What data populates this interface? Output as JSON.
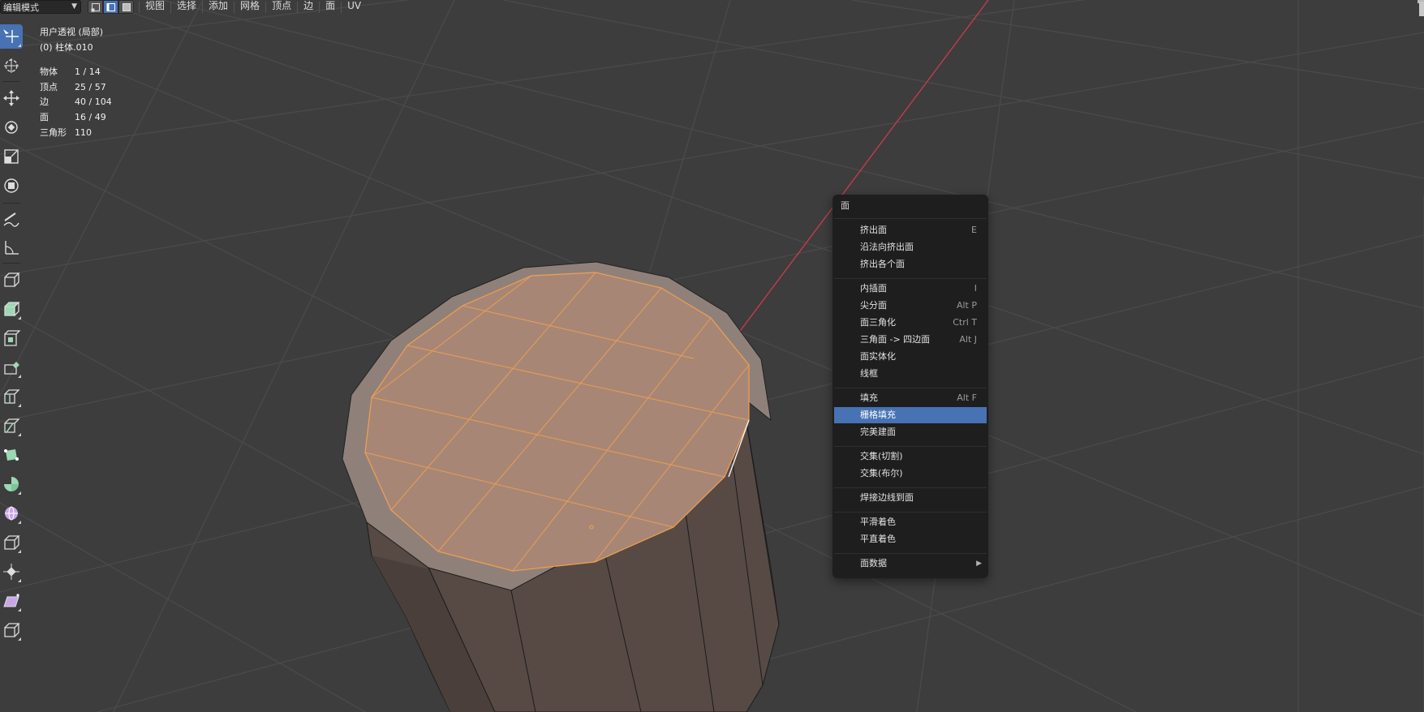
{
  "header": {
    "mode": "编辑模式",
    "menus": [
      "视图",
      "选择",
      "添加",
      "网格",
      "顶点",
      "边",
      "面",
      "UV"
    ]
  },
  "overlay": {
    "view_name": "用户透视 (局部)",
    "object_name": "(0) 柱体.010",
    "stats": [
      {
        "label": "物体",
        "value": "1 / 14"
      },
      {
        "label": "顶点",
        "value": "25 / 57"
      },
      {
        "label": "边",
        "value": "40 / 104"
      },
      {
        "label": "面",
        "value": "16 / 49"
      },
      {
        "label": "三角形",
        "value": "110"
      }
    ]
  },
  "colors": {
    "viewport_bg": "#3d3d3d",
    "accent": "#4772b3",
    "selection": "#f0a050",
    "x_axis": "#c43a4f"
  },
  "context_menu": {
    "title": "面",
    "items": [
      {
        "label": "挤出面",
        "shortcut": "E"
      },
      {
        "label": "沿法向挤出面",
        "shortcut": ""
      },
      {
        "label": "挤出各个面",
        "shortcut": ""
      },
      {
        "label": "内插面",
        "shortcut": "I"
      },
      {
        "label": "尖分面",
        "shortcut": "Alt P"
      },
      {
        "label": "面三角化",
        "shortcut": "Ctrl T"
      },
      {
        "label": "三角面 -> 四边面",
        "shortcut": "Alt J"
      },
      {
        "label": "面实体化",
        "shortcut": ""
      },
      {
        "label": "线框",
        "shortcut": ""
      },
      {
        "label": "填充",
        "shortcut": "Alt F"
      },
      {
        "label": "栅格填充",
        "shortcut": ""
      },
      {
        "label": "完美建面",
        "shortcut": ""
      },
      {
        "label": "交集(切割)",
        "shortcut": ""
      },
      {
        "label": "交集(布尔)",
        "shortcut": ""
      },
      {
        "label": "焊接边线到面",
        "shortcut": ""
      },
      {
        "label": "平滑着色",
        "shortcut": ""
      },
      {
        "label": "平直着色",
        "shortcut": ""
      },
      {
        "label": "面数据",
        "shortcut": ""
      }
    ]
  }
}
